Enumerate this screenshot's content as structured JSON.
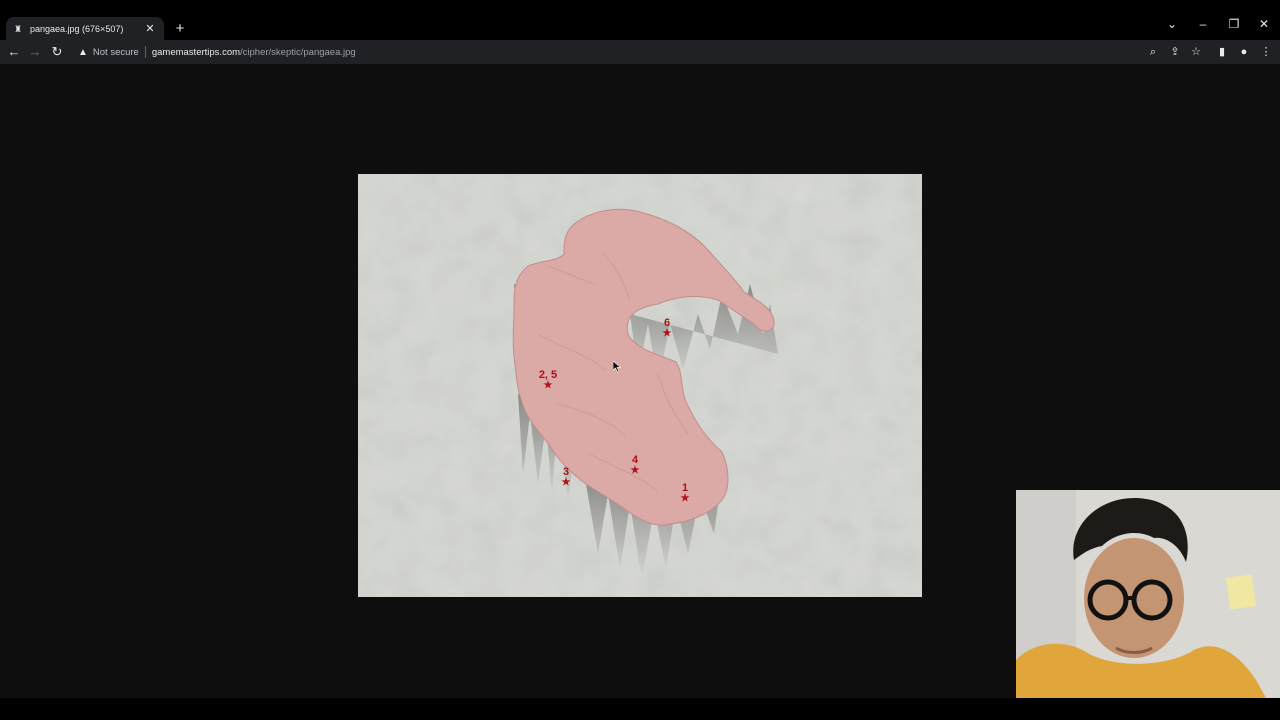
{
  "browser": {
    "tab_title": "pangaea.jpg (676×507)",
    "security_label": "Not secure",
    "url_host": "gamemastertips.com",
    "url_path": "/cipher/skeptic/pangaea.jpg"
  },
  "map": {
    "markers": [
      {
        "label": "6",
        "star": "★"
      },
      {
        "label": "2, 5",
        "star": "★"
      },
      {
        "label": "4",
        "star": "★"
      },
      {
        "label": "3",
        "star": "★"
      },
      {
        "label": "1",
        "star": "★"
      }
    ]
  },
  "colors": {
    "marker": "#b0101a",
    "landmass": "#dba9a6",
    "ocean": "#d4d6d1"
  },
  "icons": {
    "back": "arrow-left-icon",
    "forward": "arrow-right-icon",
    "reload": "reload-icon",
    "warning": "warning-icon",
    "zoom": "zoom-icon",
    "share": "share-icon",
    "bookmark": "star-icon",
    "sidepanel": "side-panel-icon",
    "profile": "profile-icon",
    "menu": "kebab-menu-icon"
  }
}
